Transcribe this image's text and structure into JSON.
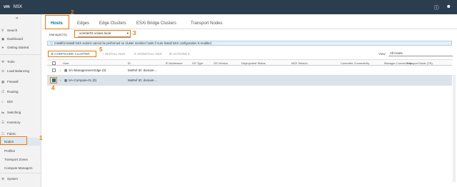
{
  "header": {
    "logo": "vm",
    "app": "NSX",
    "icons": [
      "help-icon",
      "user-icon"
    ]
  },
  "sidebar": {
    "items": [
      {
        "label": "Search",
        "icon": "search-icon"
      },
      {
        "label": "Dashboard",
        "icon": "dashboard-icon"
      },
      {
        "label": "Getting Started",
        "icon": "rocket-icon"
      },
      {
        "label": "Tools",
        "icon": "tools-icon"
      },
      {
        "label": "Load Balancing",
        "icon": "balance-icon"
      },
      {
        "label": "Firewall",
        "icon": "firewall-icon"
      },
      {
        "label": "Routing",
        "icon": "routing-icon"
      },
      {
        "label": "DDI",
        "icon": "ddi-icon"
      },
      {
        "label": "Switching",
        "icon": "switch-icon"
      },
      {
        "label": "Inventory",
        "icon": "inventory-icon"
      },
      {
        "label": "Fabric",
        "icon": "fabric-icon"
      },
      {
        "label": "Nodes",
        "icon": ""
      },
      {
        "label": "Profiles",
        "icon": ""
      },
      {
        "label": "Transport Zones",
        "icon": ""
      },
      {
        "label": "Compute Managers",
        "icon": ""
      },
      {
        "label": "System",
        "icon": "system-icon"
      }
    ]
  },
  "tabs": [
    "Hosts",
    "Edges",
    "Edge Clusters",
    "ESXi Bridge Clusters",
    "Transport Nodes"
  ],
  "filter": {
    "label": "Managed by",
    "value": "vcenter01.vclass.local"
  },
  "banner": "Install/Uninstall NSX actions cannot be performed on cluster member hosts if Auto-Install NSX configuration is enabled.",
  "actions": {
    "configure": "CONFIGURE CLUSTER",
    "install": "INSTALL NSX",
    "uninstall": "UNINSTALL NSX",
    "more": "ACTIONS"
  },
  "view": {
    "label": "View",
    "value": "All Hosts"
  },
  "table": {
    "headers": [
      "Host",
      "ID",
      "IP Addresses",
      "OS Type",
      "OS Version",
      "Deployment Status",
      "NSX Version",
      "Controller Connectivity",
      "Manager Connectivity",
      "Transport Node (TN)"
    ],
    "rows": [
      {
        "host": "SA-Management-Edge (0)",
        "id": "MoRef ID: domain-...",
        "selected": false
      },
      {
        "host": "SA-Compute-01 (0)",
        "id": "MoRef ID: domain-...",
        "selected": true
      }
    ]
  },
  "callouts": [
    "1",
    "2",
    "3",
    "4",
    "5"
  ],
  "colors": {
    "accent": "#0072a3",
    "highlight": "#f07800",
    "topbar": "#2b3e50"
  }
}
